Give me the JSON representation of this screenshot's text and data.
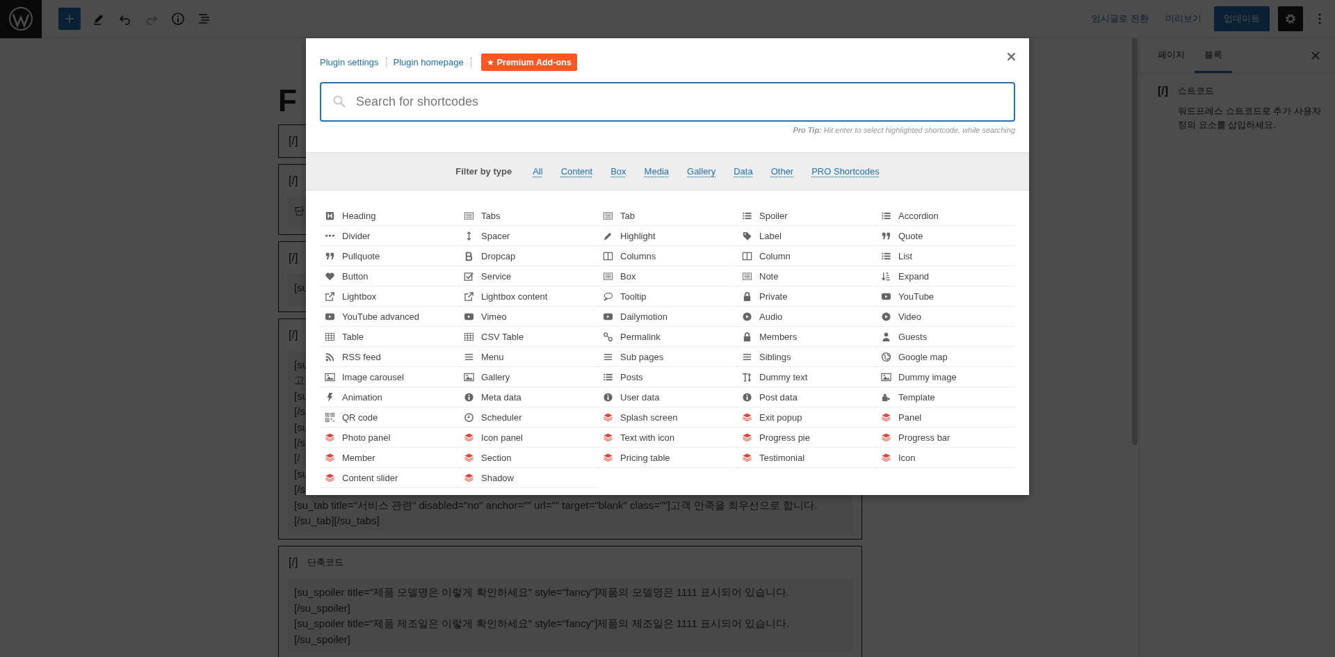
{
  "topbar": {
    "links": [
      "임시글로 전환",
      "미리보기"
    ],
    "update_button": "업데이트",
    "settings_pressed": true
  },
  "editor": {
    "title": "F",
    "blocks": [
      {
        "label": "[/]"
      },
      {
        "label": "[/]",
        "lines": [
          "단"
        ]
      },
      {
        "label": "[/]",
        "lines": [
          "[su"
        ]
      },
      {
        "label": "[/]",
        "lines": [
          "[su",
          "고",
          "[su",
          "[/s",
          "[su",
          "[/s",
          "[/",
          "[su",
          "[/s",
          "[su_tab title=\"서비스 관련\" disabled=\"no\" anchor=\"\" url=\"\" target=\"blank\" class=\"\"]고객 만족을 최우선으로 합니다.",
          "[/su_tab][/su_tabs]"
        ]
      },
      {
        "label": "[/]",
        "title": "단축코드",
        "lines": [
          "[su_spoiler title=\"제품 모델명은 이렇게 확인하세요\" style=\"fancy\"]제품의 모델명은 1111 표시되어 있습니다.",
          "[/su_spoiler]",
          "[su_spoiler title=\"제품 제조일은 이렇게 확인하세요\" style=\"fancy\"]제품의 제조일은 1111 표시되어 있습니다.",
          "[/su_spoiler]"
        ]
      }
    ]
  },
  "sidebar": {
    "tabs": [
      {
        "label": "페이지",
        "selected": false
      },
      {
        "label": "블록",
        "selected": true
      }
    ],
    "block": {
      "icon_text": "[/]",
      "name": "쇼트코드",
      "description": "워드프레스 쇼트코드로 추가 사용자 정의 요소를 삽입하세요."
    }
  },
  "modal": {
    "links": [
      "Plugin settings",
      "Plugin homepage"
    ],
    "premium_button": "★ Premium Add-ons",
    "search": {
      "placeholder": "Search for shortcodes"
    },
    "tip": "**Pro Tip:** Hit enter to select highlighted shortcode, while searching",
    "filter": {
      "label": "Filter by type",
      "types": [
        "All",
        "Content",
        "Box",
        "Media",
        "Gallery",
        "Data",
        "Other",
        "PRO Shortcodes"
      ]
    },
    "items": [
      {
        "name": "Heading",
        "kind": "standard"
      },
      {
        "name": "Tabs",
        "kind": "standard"
      },
      {
        "name": "Tab",
        "kind": "standard"
      },
      {
        "name": "Spoiler",
        "kind": "standard"
      },
      {
        "name": "Accordion",
        "kind": "standard"
      },
      {
        "name": "Divider",
        "kind": "standard"
      },
      {
        "name": "Spacer",
        "kind": "standard"
      },
      {
        "name": "Highlight",
        "kind": "standard"
      },
      {
        "name": "Label",
        "kind": "standard"
      },
      {
        "name": "Quote",
        "kind": "standard"
      },
      {
        "name": "Pullquote",
        "kind": "standard"
      },
      {
        "name": "Dropcap",
        "kind": "standard"
      },
      {
        "name": "Columns",
        "kind": "standard"
      },
      {
        "name": "Column",
        "kind": "standard"
      },
      {
        "name": "List",
        "kind": "standard"
      },
      {
        "name": "Button",
        "kind": "standard"
      },
      {
        "name": "Service",
        "kind": "standard"
      },
      {
        "name": "Box",
        "kind": "standard"
      },
      {
        "name": "Note",
        "kind": "standard"
      },
      {
        "name": "Expand",
        "kind": "standard"
      },
      {
        "name": "Lightbox",
        "kind": "standard"
      },
      {
        "name": "Lightbox content",
        "kind": "standard"
      },
      {
        "name": "Tooltip",
        "kind": "standard"
      },
      {
        "name": "Private",
        "kind": "standard"
      },
      {
        "name": "YouTube",
        "kind": "standard"
      },
      {
        "name": "YouTube advanced",
        "kind": "standard"
      },
      {
        "name": "Vimeo",
        "kind": "standard"
      },
      {
        "name": "Dailymotion",
        "kind": "standard"
      },
      {
        "name": "Audio",
        "kind": "standard"
      },
      {
        "name": "Video",
        "kind": "standard"
      },
      {
        "name": "Table",
        "kind": "standard"
      },
      {
        "name": "CSV Table",
        "kind": "standard"
      },
      {
        "name": "Permalink",
        "kind": "standard"
      },
      {
        "name": "Members",
        "kind": "standard"
      },
      {
        "name": "Guests",
        "kind": "standard"
      },
      {
        "name": "RSS feed",
        "kind": "standard"
      },
      {
        "name": "Menu",
        "kind": "standard"
      },
      {
        "name": "Sub pages",
        "kind": "standard"
      },
      {
        "name": "Siblings",
        "kind": "standard"
      },
      {
        "name": "Google map",
        "kind": "standard"
      },
      {
        "name": "Image carousel",
        "kind": "standard"
      },
      {
        "name": "Gallery",
        "kind": "standard"
      },
      {
        "name": "Posts",
        "kind": "standard"
      },
      {
        "name": "Dummy text",
        "kind": "standard"
      },
      {
        "name": "Dummy image",
        "kind": "standard"
      },
      {
        "name": "Animation",
        "kind": "standard"
      },
      {
        "name": "Meta data",
        "kind": "standard"
      },
      {
        "name": "User data",
        "kind": "standard"
      },
      {
        "name": "Post data",
        "kind": "standard"
      },
      {
        "name": "Template",
        "kind": "standard"
      },
      {
        "name": "QR code",
        "kind": "standard"
      },
      {
        "name": "Scheduler",
        "kind": "standard"
      },
      {
        "name": "Splash screen",
        "kind": "pro"
      },
      {
        "name": "Exit popup",
        "kind": "pro"
      },
      {
        "name": "Panel",
        "kind": "pro"
      },
      {
        "name": "Photo panel",
        "kind": "pro"
      },
      {
        "name": "Icon panel",
        "kind": "pro"
      },
      {
        "name": "Text with icon",
        "kind": "pro"
      },
      {
        "name": "Progress pie",
        "kind": "pro"
      },
      {
        "name": "Progress bar",
        "kind": "pro"
      },
      {
        "name": "Member",
        "kind": "pro"
      },
      {
        "name": "Section",
        "kind": "pro"
      },
      {
        "name": "Pricing table",
        "kind": "pro"
      },
      {
        "name": "Testimonial",
        "kind": "pro"
      },
      {
        "name": "Icon",
        "kind": "pro"
      },
      {
        "name": "Content slider",
        "kind": "pro"
      },
      {
        "name": "Shadow",
        "kind": "pro"
      }
    ]
  }
}
